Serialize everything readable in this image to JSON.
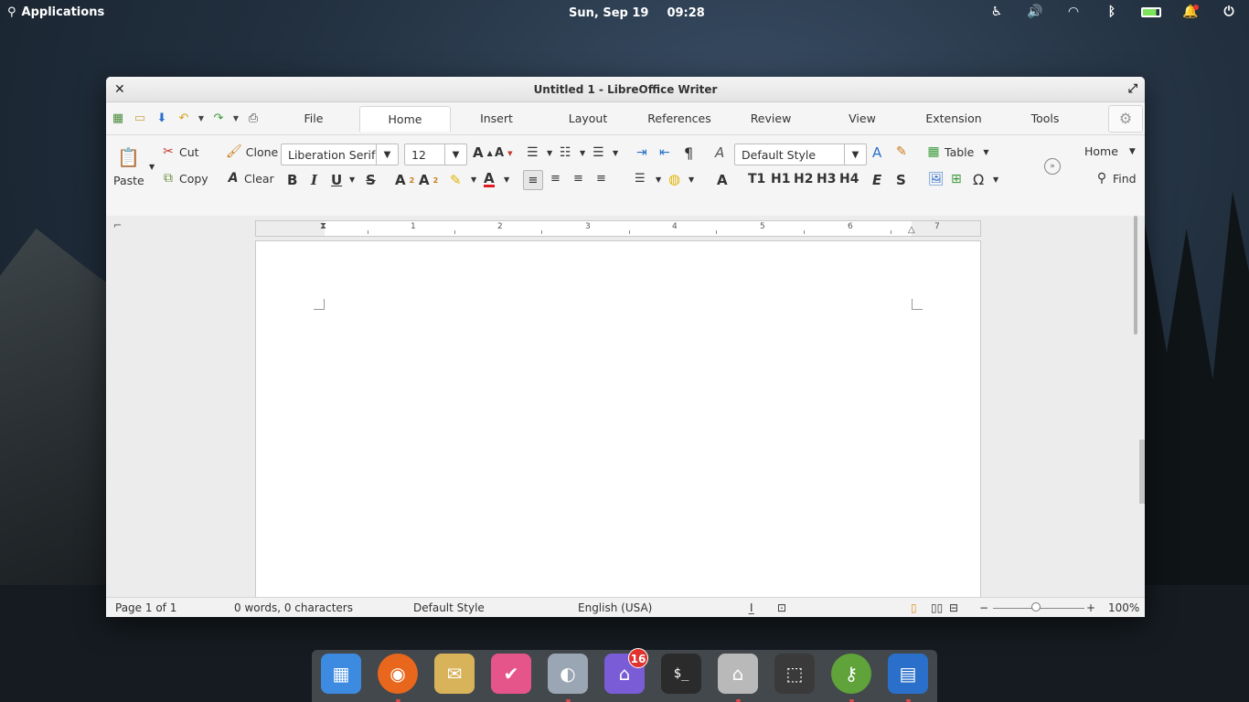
{
  "top_panel": {
    "applications_label": "Applications",
    "date": "Sun, Sep 19",
    "time": "09:28",
    "tray_icons": [
      "accessibility-icon",
      "volume-icon",
      "wifi-icon",
      "bluetooth-icon",
      "battery-icon",
      "notifications-icon",
      "power-icon"
    ]
  },
  "window": {
    "title": "Untitled 1 - LibreOffice Writer"
  },
  "quick_tools": [
    "new-document-icon",
    "open-folder-icon",
    "save-icon",
    "undo-icon",
    "redo-icon",
    "print-icon"
  ],
  "tabs": [
    {
      "label": "File",
      "active": false
    },
    {
      "label": "Home",
      "active": true
    },
    {
      "label": "Insert",
      "active": false
    },
    {
      "label": "Layout",
      "active": false
    },
    {
      "label": "References",
      "active": false
    },
    {
      "label": "Review",
      "active": false
    },
    {
      "label": "View",
      "active": false
    },
    {
      "label": "Extension",
      "active": false
    },
    {
      "label": "Tools",
      "active": false
    }
  ],
  "toolbar": {
    "paste": "Paste",
    "cut": "Cut",
    "copy": "Copy",
    "clone": "Clone",
    "clear": "Clear",
    "font_name": "Liberation Serif",
    "font_size": "12",
    "paragraph_style": "Default Style",
    "table": "Table",
    "home_dropdown": "Home",
    "find": "Find",
    "bold": "B",
    "italic": "I",
    "underline": "U",
    "strike": "S",
    "heading_labels": [
      "T1",
      "H1",
      "H2",
      "H3",
      "H4"
    ]
  },
  "ruler": {
    "numbers": [
      "1",
      "2",
      "3",
      "4",
      "5",
      "6",
      "7"
    ]
  },
  "status": {
    "page": "Page 1 of 1",
    "words": "0 words, 0 characters",
    "style": "Default Style",
    "language": "English (USA)",
    "zoom": "100%"
  },
  "dock": {
    "items": [
      {
        "name": "multitasking-view-icon",
        "color": "#3d8be0"
      },
      {
        "name": "firefox-icon",
        "color": "#e8671d"
      },
      {
        "name": "mail-icon",
        "color": "#d9b35a"
      },
      {
        "name": "tasks-icon",
        "color": "#e6558a"
      },
      {
        "name": "settings-toggle-icon",
        "color": "#9aa6b3"
      },
      {
        "name": "appcenter-icon",
        "color": "#7a5dd6",
        "badge": "16"
      },
      {
        "name": "terminal-icon",
        "color": "#2b2b2b"
      },
      {
        "name": "files-icon",
        "color": "#b9b9b9"
      },
      {
        "name": "screenshot-icon",
        "color": "#3a3a3a"
      },
      {
        "name": "keyring-icon",
        "color": "#5fa33a"
      },
      {
        "name": "writer-icon",
        "color": "#2a6fc9"
      }
    ]
  },
  "colors": {
    "accent_active_tab": "#ffffff",
    "highlight": "#f6d32d",
    "font_color": "#e01b24",
    "badge": "#e0322e"
  }
}
